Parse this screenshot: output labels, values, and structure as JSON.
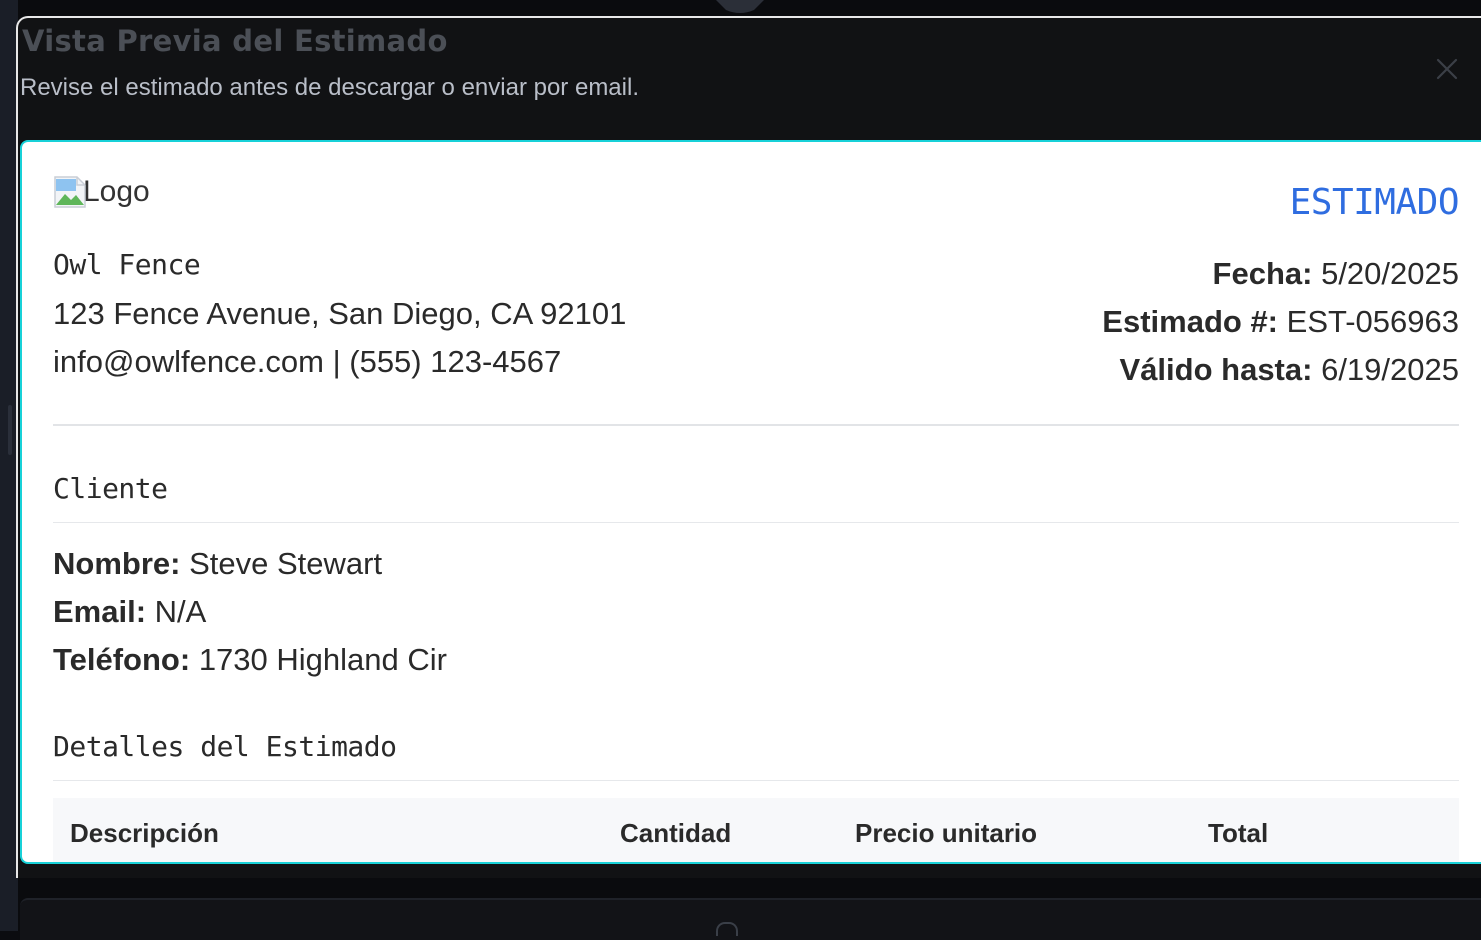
{
  "dialog": {
    "title": "Vista Previa del Estimado",
    "description": "Revise el estimado antes de descargar o enviar por email.",
    "close_icon": "close-icon"
  },
  "estimate": {
    "logo_alt": "Logo",
    "heading": "ESTIMADO",
    "company": {
      "name": "Owl Fence",
      "address": "123 Fence Avenue, San Diego, CA 92101",
      "contact": "info@owlfence.com | (555) 123-4567"
    },
    "meta": {
      "date_label": "Fecha:",
      "date_value": "5/20/2025",
      "number_label": "Estimado #:",
      "number_value": "EST-056963",
      "valid_label": "Válido hasta:",
      "valid_value": "6/19/2025"
    },
    "client": {
      "section_title": "Cliente",
      "name_label": "Nombre:",
      "name_value": "Steve Stewart",
      "email_label": "Email:",
      "email_value": "N/A",
      "phone_label": "Teléfono:",
      "phone_value": "1730 Highland Cir"
    },
    "details": {
      "section_title": "Detalles del Estimado",
      "columns": [
        "Descripción",
        "Cantidad",
        "Precio unitario",
        "Total"
      ]
    }
  },
  "colors": {
    "accent_heading": "#2f6de0",
    "document_border": "#18d1d8",
    "dialog_background": "#111214"
  }
}
